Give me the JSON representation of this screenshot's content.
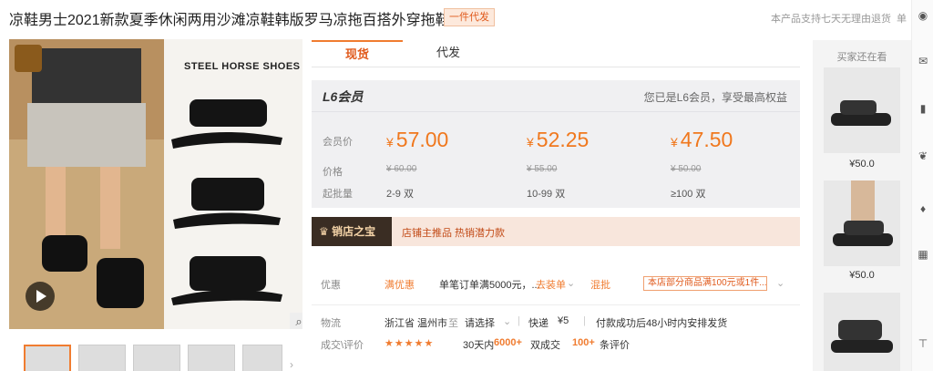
{
  "header": {
    "title": "凉鞋男士2021新款夏季休闲两用沙滩凉鞋韩版罗马凉拖百搭外穿拖鞋",
    "tag": "一件代发",
    "refund_note": "本产品支持七天无理由退货",
    "refund_more": "单"
  },
  "gallery": {
    "brand_text": "STEEL HORSE SHOES",
    "zoom_icon": "magnifier-icon",
    "play_icon": "play-icon"
  },
  "tabs": [
    {
      "label": "现货",
      "active": true
    },
    {
      "label": "代发",
      "active": false
    }
  ],
  "pricing": {
    "member_logo": "L6会员",
    "member_note": "您已是L6会员，享受最高权益",
    "labels": {
      "member_price": "会员价",
      "price": "价格",
      "moq": "起批量"
    },
    "tiers": [
      {
        "currency": "¥",
        "member_price": "57.00",
        "original": "¥ 60.00",
        "moq": "2-9 双"
      },
      {
        "currency": "¥",
        "member_price": "52.25",
        "original": "¥ 55.00",
        "moq": "10-99 双"
      },
      {
        "currency": "¥",
        "member_price": "47.50",
        "original": "¥ 50.00",
        "moq": "≥100 双"
      }
    ]
  },
  "banner": {
    "badge": "销店之宝",
    "text": "店铺主推品  热销潜力款"
  },
  "info": {
    "promo_label": "优惠",
    "promo_full": "满优惠",
    "promo_desc": "单笔订单满5000元，...",
    "promo_action": "去装单",
    "promo_batch": "混批",
    "promo_box": "本店部分商品满100元或1件...",
    "logistics_label": "物流",
    "origin": "浙江省 温州市",
    "to": "至",
    "destination": "请选择",
    "express": "快递",
    "fee": "¥5",
    "ship_note": "付款成功后48小时内安排发货",
    "deal_label": "成交\\评价",
    "stars": "★★★★★",
    "days": "30天内",
    "deals": "6000+",
    "deals_unit": "双成交",
    "reviews": "100+",
    "reviews_unit": "条评价"
  },
  "rail": {
    "title": "买家还在看",
    "items": [
      {
        "price": "¥50.0"
      },
      {
        "price": "¥50.0"
      },
      {
        "price": ""
      }
    ]
  },
  "toolbar": {
    "icons": [
      "user-icon",
      "mail-icon",
      "bookmark-icon",
      "footprint-icon",
      "bell-icon",
      "calendar-icon",
      "top-icon"
    ]
  },
  "colors": {
    "accent": "#f07c30",
    "price": "#f0781e",
    "banner_dark": "#3a2d23"
  }
}
